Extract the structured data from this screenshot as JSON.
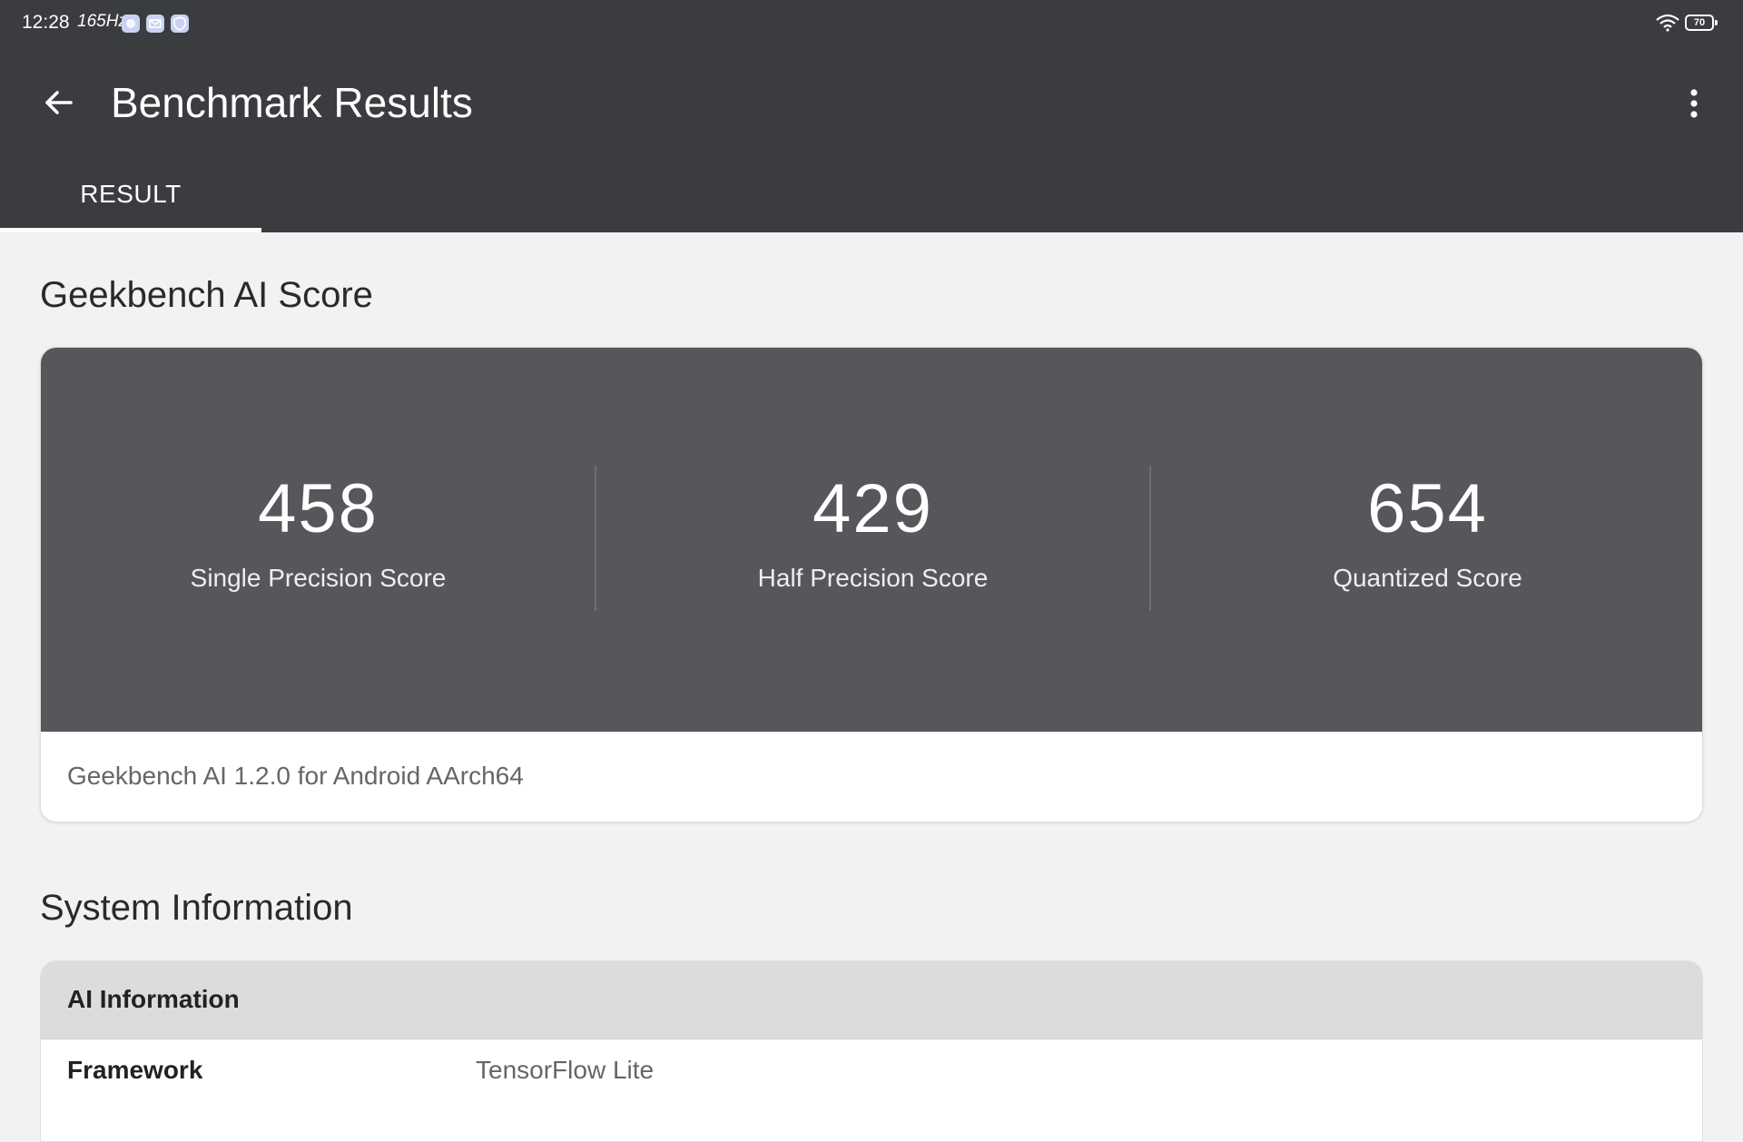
{
  "status_bar": {
    "time": "12:28",
    "refresh_rate": "165Hz",
    "battery": "70",
    "notification_icons": [
      "app-notification-icon",
      "mail-icon",
      "shield-icon"
    ]
  },
  "header": {
    "title": "Benchmark Results",
    "back_icon": "arrow-left-icon",
    "menu_icon": "more-vertical-icon"
  },
  "tabs": [
    {
      "label": "RESULT",
      "active": true
    }
  ],
  "score_section": {
    "title": "Geekbench AI Score",
    "scores": [
      {
        "value": "458",
        "label": "Single Precision Score"
      },
      {
        "value": "429",
        "label": "Half Precision Score"
      },
      {
        "value": "654",
        "label": "Quantized Score"
      }
    ],
    "version": "Geekbench AI 1.2.0 for Android AArch64"
  },
  "system_section": {
    "title": "System Information",
    "group_title": "AI Information",
    "rows": [
      {
        "key": "Framework",
        "value": "TensorFlow Lite"
      }
    ]
  },
  "colors": {
    "appbar": "#3b3c40",
    "score_panel": "#56575b",
    "background": "#f2f2f2",
    "card": "#ffffff"
  }
}
